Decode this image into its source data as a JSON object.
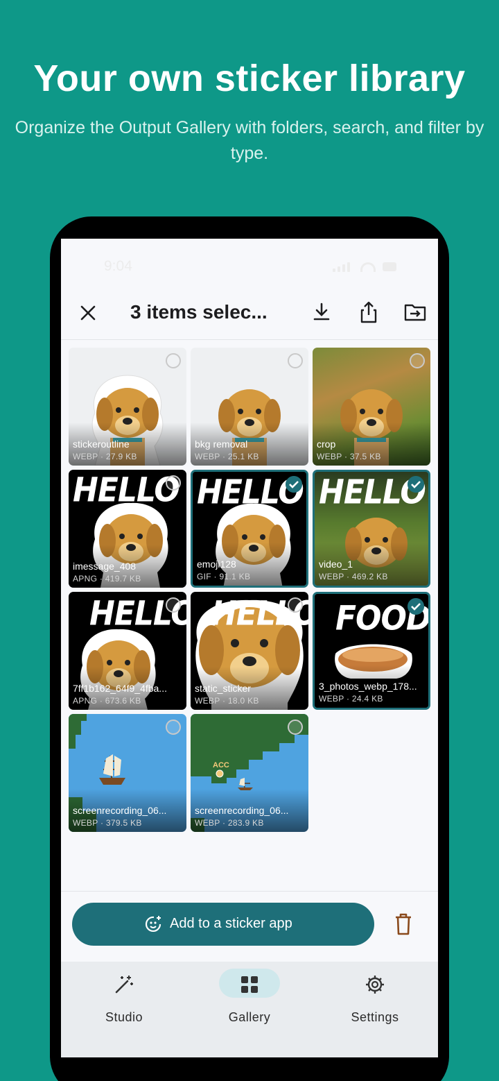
{
  "promo": {
    "headline": "Your own sticker library",
    "subhead": "Organize the Output Gallery with folders, search, and filter by type."
  },
  "status_bar": {
    "time": "9:04"
  },
  "app_bar": {
    "title": "3 items selec...",
    "icons": [
      "close-icon",
      "download-icon",
      "share-icon",
      "move-to-folder-icon"
    ]
  },
  "gallery": {
    "items": [
      {
        "name": "stickeroutline",
        "meta": "WEBP · 27.9 KB",
        "selected": false
      },
      {
        "name": "bkg removal",
        "meta": "WEBP · 25.1 KB",
        "selected": false
      },
      {
        "name": "crop",
        "meta": "WEBP · 37.5 KB",
        "selected": false
      },
      {
        "name": "imessage_408",
        "meta": "APNG · 419.7 KB",
        "selected": false,
        "overlay_text": "HELLO"
      },
      {
        "name": "emoji128",
        "meta": "GIF · 91.1 KB",
        "selected": true,
        "overlay_text": "HELLO"
      },
      {
        "name": "video_1",
        "meta": "WEBP · 469.2 KB",
        "selected": true,
        "overlay_text": "HELLO"
      },
      {
        "name": "7ff1b162_64f9_4fba...",
        "meta": "APNG · 673.6 KB",
        "selected": false,
        "overlay_text": "HELLO"
      },
      {
        "name": "static_sticker",
        "meta": "WEBP · 18.0 KB",
        "selected": false,
        "overlay_text": "HELLO"
      },
      {
        "name": "3_photos_webp_178...",
        "meta": "WEBP · 24.4 KB",
        "selected": true,
        "overlay_text": "FOOD"
      },
      {
        "name": "screenrecording_06...",
        "meta": "WEBP · 379.5 KB",
        "selected": false
      },
      {
        "name": "screenrecording_06...",
        "meta": "WEBP · 283.9 KB",
        "selected": false,
        "overlay_text": "ACC"
      }
    ]
  },
  "actions": {
    "add_label": "Add to a sticker app",
    "add_icon": "sticker-smile-icon",
    "delete_icon": "trash-icon",
    "accent": "#1e6f79",
    "delete_color": "#8a4a1c"
  },
  "nav": {
    "items": [
      {
        "label": "Studio",
        "icon": "magic-wand-icon",
        "active": false
      },
      {
        "label": "Gallery",
        "icon": "grid-icon",
        "active": true
      },
      {
        "label": "Settings",
        "icon": "gear-icon",
        "active": false
      }
    ]
  },
  "colors": {
    "background": "#0e9888",
    "nav_active_pill": "#cfe8ec"
  }
}
